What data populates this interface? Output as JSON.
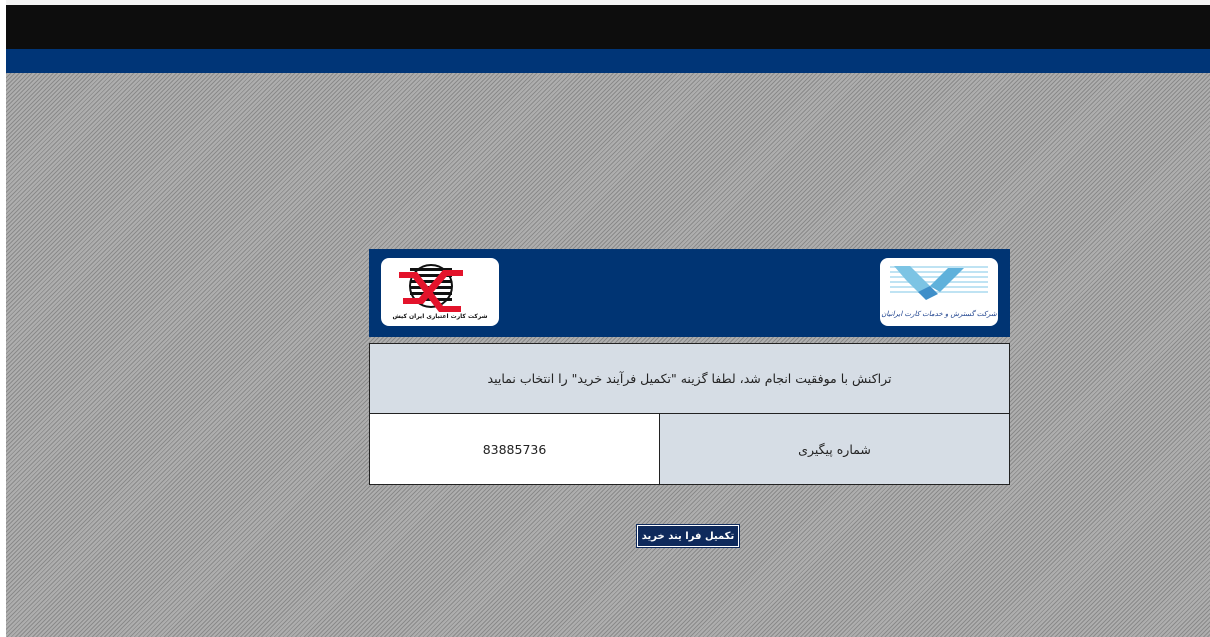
{
  "logos": {
    "left_caption": "شرکت کارت اعتباری ایران کیش",
    "right_caption": "شرکت گسترش و خدمات کارت ایرانیان"
  },
  "result": {
    "message": "تراکنش با موفقیت انجام شد، لطفا گزینه \"تکمیل فرآیند خرید\" را انتخاب نمایید",
    "tracking_label": "شماره پیگیری",
    "tracking_number": "83885736"
  },
  "actions": {
    "complete_label": "تکمیل فرا یند خرید"
  },
  "colors": {
    "header_navy": "#003473",
    "top_black": "#0d0d0d",
    "blue_bar": "#003577",
    "cell_bg": "#d6dde5",
    "button_bg": "#0f2a5c"
  },
  "icons": {
    "left_logo": "iran-kish-globe-logo",
    "right_logo": "bird-card-logo"
  }
}
